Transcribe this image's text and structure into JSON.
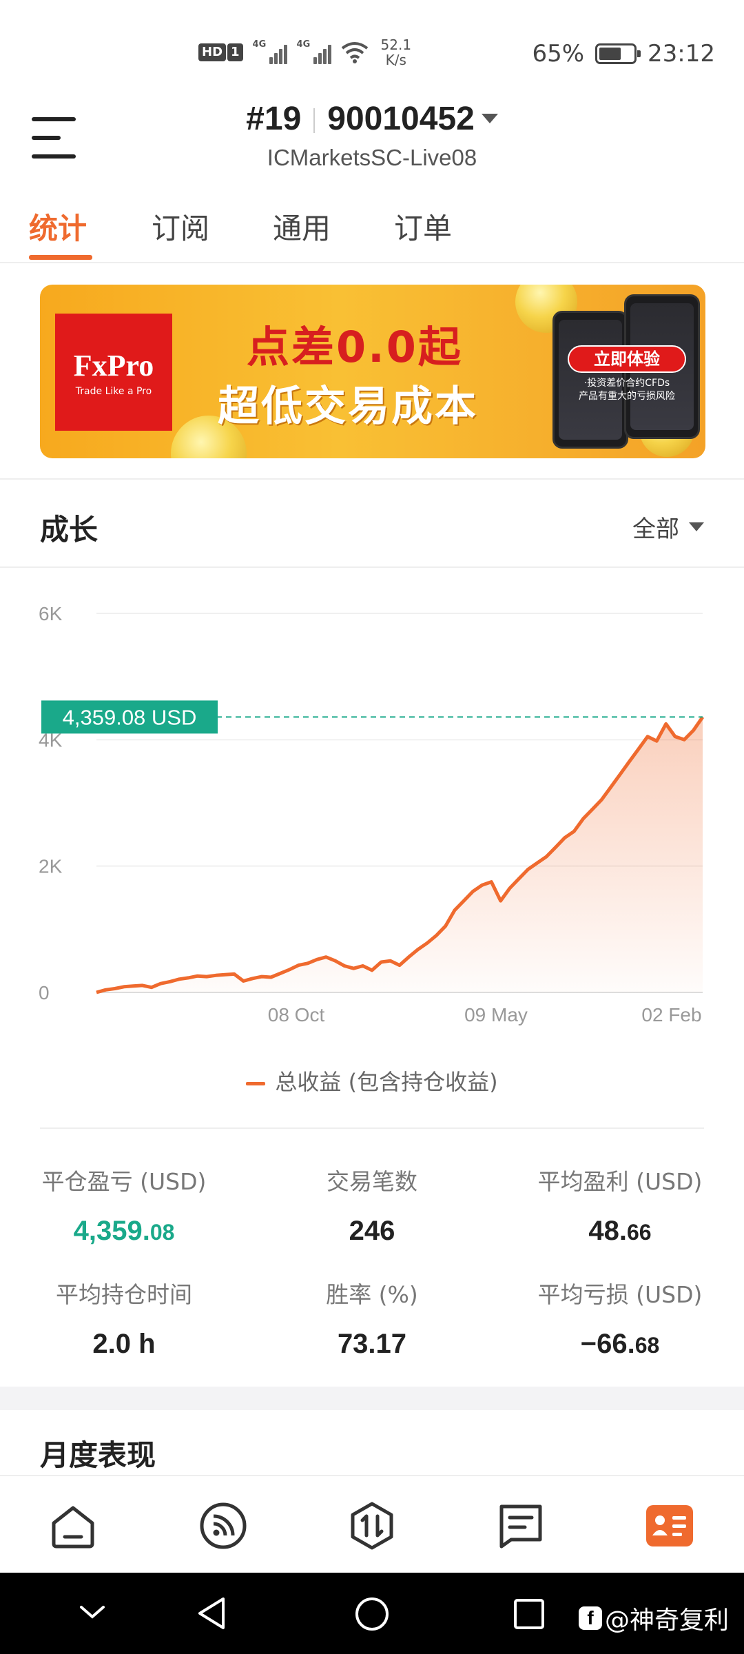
{
  "status_bar": {
    "hd": "HD",
    "sim": "1",
    "net1": "4G",
    "net2": "4G",
    "speed_value": "52.1",
    "speed_unit": "K/s",
    "battery": "65%",
    "battery_level": 0.65,
    "time": "23:12"
  },
  "header": {
    "rank": "#19",
    "account": "90010452",
    "server": "ICMarketsSC-Live08"
  },
  "tabs": [
    "统计",
    "订阅",
    "通用",
    "订单"
  ],
  "banner": {
    "brand": "FxPro",
    "tagline": "Trade Like a Pro",
    "line1": "点差0.0起",
    "line2": "超低交易成本",
    "cta": "立即体验",
    "note1": "·投资差价合约CFDs",
    "note2": "产品有重大的亏损风险"
  },
  "growth": {
    "title": "成长",
    "range": "全部"
  },
  "chart_data": {
    "type": "area",
    "y_ticks": [
      "6K",
      "4K",
      "2K",
      "0"
    ],
    "x_ticks": [
      "08 Oct",
      "09 May",
      "02 Feb"
    ],
    "ylim": [
      0,
      6000
    ],
    "current_label": "4,359.08 USD",
    "current_value": 4359.08,
    "legend": "总收益 (包含持仓收益)",
    "line_color": "#ef6a2e",
    "marker_color": "#1aa98a",
    "series": [
      {
        "values": [
          0,
          40,
          60,
          90,
          100,
          110,
          80,
          140,
          170,
          210,
          230,
          260,
          250,
          270,
          280,
          290,
          180,
          220,
          250,
          240,
          300,
          360,
          430,
          460,
          520,
          560,
          500,
          420,
          380,
          420,
          350,
          480,
          500,
          430,
          560,
          680,
          780,
          900,
          1050,
          1300,
          1450,
          1600,
          1700,
          1750,
          1450,
          1650,
          1800,
          1950,
          2050,
          2150,
          2300,
          2450,
          2550,
          2750,
          2900,
          3050,
          3250,
          3450,
          3650,
          3850,
          4050,
          3980,
          4250,
          4050,
          4000,
          4150,
          4359.08
        ]
      }
    ]
  },
  "stats": [
    {
      "label": "平仓盈亏 (USD)",
      "int": "4,359.",
      "dec": "08"
    },
    {
      "label": "交易笔数",
      "int": "246",
      "dec": ""
    },
    {
      "label": "平均盈利 (USD)",
      "int": "48.",
      "dec": "66"
    },
    {
      "label": "平均持仓时间",
      "int": "2.0 h",
      "dec": ""
    },
    {
      "label": "胜率 (%)",
      "int": "73.17",
      "dec": ""
    },
    {
      "label": "平均亏损 (USD)",
      "int": "−66.",
      "dec": "68"
    }
  ],
  "monthly": {
    "title": "月度表现"
  },
  "bottom_nav": [
    "home-icon",
    "feed-icon",
    "trade-icon",
    "news-icon",
    "profile-icon"
  ],
  "watermark": "@神奇复利"
}
